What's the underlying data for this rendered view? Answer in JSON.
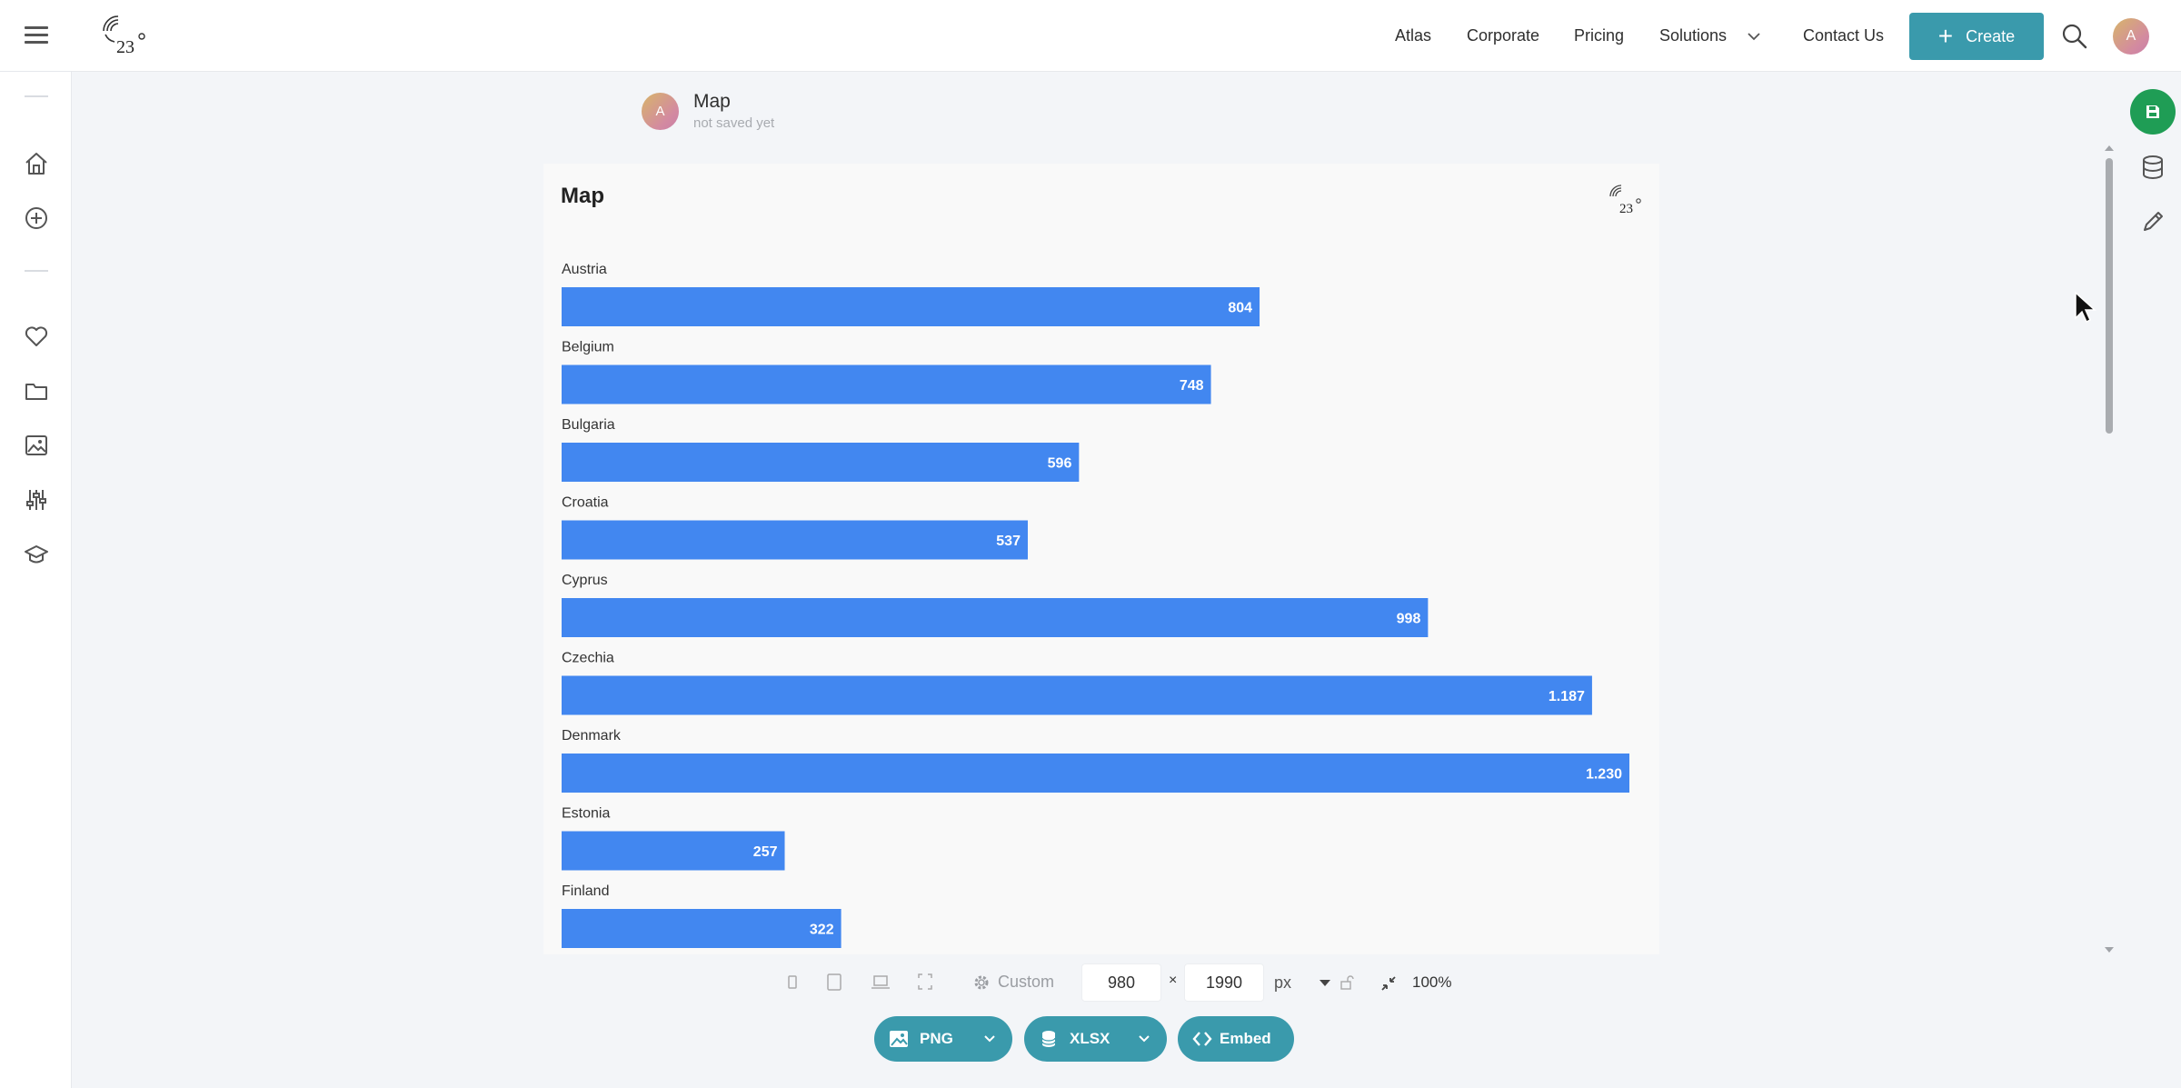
{
  "nav": {
    "items": [
      "Atlas",
      "Corporate",
      "Pricing",
      "Solutions",
      "Contact Us"
    ],
    "create_label": "Create",
    "avatar_initial": "A"
  },
  "doc": {
    "avatar_initial": "A",
    "title": "Map",
    "status": "not saved yet"
  },
  "chart_data": {
    "type": "bar",
    "orientation": "horizontal",
    "title": "Map",
    "categories": [
      "Austria",
      "Belgium",
      "Bulgaria",
      "Croatia",
      "Cyprus",
      "Czechia",
      "Denmark",
      "Estonia",
      "Finland"
    ],
    "values": [
      804,
      748,
      596,
      537,
      998,
      1187,
      1230,
      257,
      322
    ],
    "value_labels": [
      "804",
      "748",
      "596",
      "537",
      "998",
      "1.187",
      "1.230",
      "257",
      "322"
    ],
    "bar_color": "#4287f0",
    "label_color": "#ffffff"
  },
  "toolbar": {
    "preset_label": "Custom",
    "width_value": "980",
    "height_value": "1990",
    "times": "×",
    "unit": "px",
    "zoom": "100%"
  },
  "exports": {
    "png_label": "PNG",
    "xlsx_label": "XLSX",
    "embed_label": "Embed"
  },
  "colors": {
    "accent": "#3a9aac",
    "save": "#1f9d55",
    "bar": "#4287f0"
  }
}
